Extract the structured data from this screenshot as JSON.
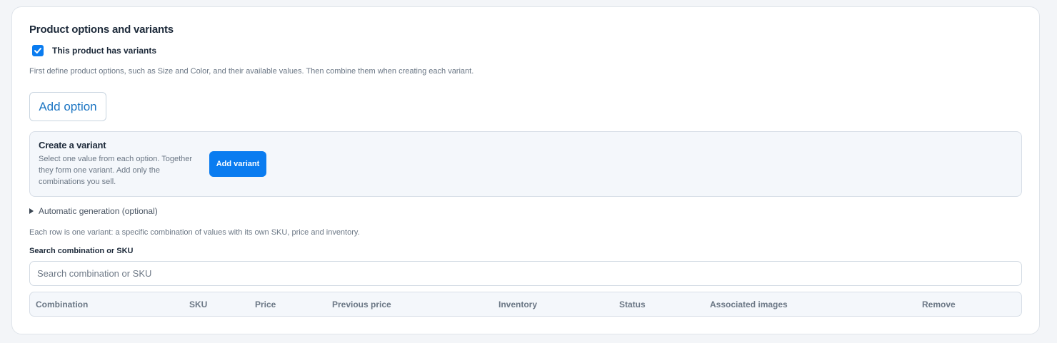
{
  "section": {
    "title": "Product options and variants",
    "has_variants_label": "This product has variants",
    "has_variants_checked": true,
    "options_help": "First define product options, such as Size and Color, and their available values. Then combine them when creating each variant.",
    "add_option_label": "Add option"
  },
  "create_variant": {
    "title": "Create a variant",
    "description": "Select one value from each option. Together they form one variant. Add only the combinations you sell.",
    "add_variant_label": "Add variant"
  },
  "auto_generation_label": "Automatic generation (optional)",
  "variants_help": "Each row is one variant: a specific combination of values with its own SKU, price and inventory.",
  "search": {
    "label": "Search combination or SKU",
    "placeholder": "Search combination or SKU"
  },
  "table": {
    "columns": [
      "Combination",
      "SKU",
      "Price",
      "Previous price",
      "Inventory",
      "Status",
      "Associated images",
      "Remove"
    ]
  },
  "colors": {
    "accent": "#0a7cf0",
    "link": "#1a74c2"
  }
}
